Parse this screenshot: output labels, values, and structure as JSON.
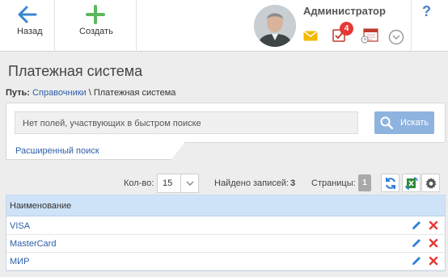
{
  "toolbar": {
    "back_label": "Назад",
    "create_label": "Создать"
  },
  "header": {
    "username": "Администратор",
    "tasks_badge": "4",
    "help": "?"
  },
  "page": {
    "title": "Платежная система",
    "breadcrumb_prefix": "Путь:",
    "breadcrumb_link": "Справочники",
    "breadcrumb_separator": " \\ ",
    "breadcrumb_current": "Платежная система"
  },
  "search": {
    "placeholder": "Нет полей, участвующих в быстром поиске",
    "button_label": "Искать",
    "advanced_label": "Расширенный поиск"
  },
  "controls": {
    "qty_label": "Кол-во:",
    "qty_value": "15",
    "found_label": "Найдено записей:",
    "found_count": "3",
    "pages_label": "Страницы:",
    "pages_value": "1"
  },
  "table": {
    "header": "Наименование",
    "rows": [
      "VISA",
      "MasterCard",
      "МИР"
    ]
  },
  "colors": {
    "accent": "#2d5ea8",
    "create_green": "#5cb85c",
    "delete_red": "#e53935",
    "header_blue": "#cfe3f8"
  }
}
